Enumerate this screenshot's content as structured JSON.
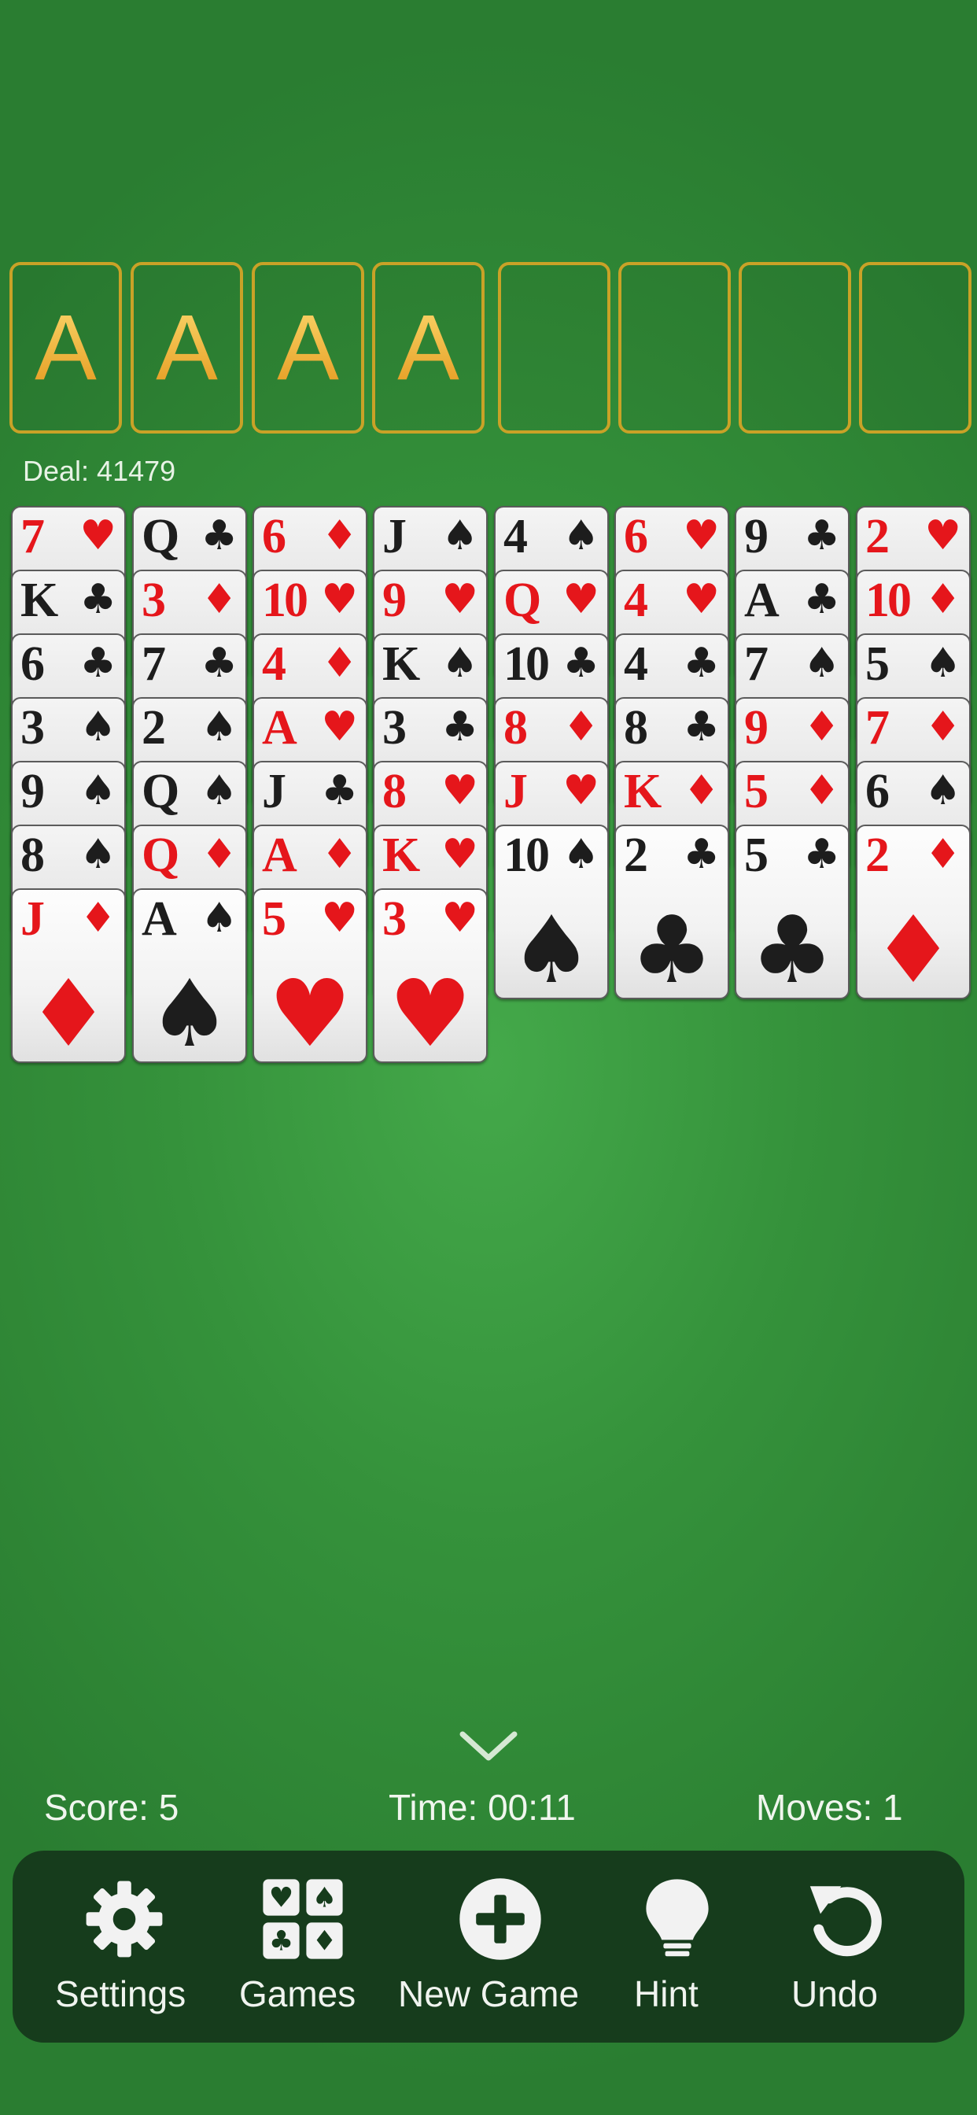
{
  "foundations": [
    "A",
    "A",
    "A",
    "A"
  ],
  "freecells": [
    "",
    "",
    "",
    ""
  ],
  "deal_label": "Deal: 41479",
  "columns": [
    [
      {
        "rank": "7",
        "suit": "hearts"
      },
      {
        "rank": "K",
        "suit": "clubs"
      },
      {
        "rank": "6",
        "suit": "clubs"
      },
      {
        "rank": "3",
        "suit": "spades"
      },
      {
        "rank": "9",
        "suit": "spades"
      },
      {
        "rank": "8",
        "suit": "spades"
      },
      {
        "rank": "J",
        "suit": "diamonds"
      }
    ],
    [
      {
        "rank": "Q",
        "suit": "clubs"
      },
      {
        "rank": "3",
        "suit": "diamonds"
      },
      {
        "rank": "7",
        "suit": "clubs"
      },
      {
        "rank": "2",
        "suit": "spades"
      },
      {
        "rank": "Q",
        "suit": "spades"
      },
      {
        "rank": "Q",
        "suit": "diamonds"
      },
      {
        "rank": "A",
        "suit": "spades"
      }
    ],
    [
      {
        "rank": "6",
        "suit": "diamonds"
      },
      {
        "rank": "10",
        "suit": "hearts"
      },
      {
        "rank": "4",
        "suit": "diamonds"
      },
      {
        "rank": "A",
        "suit": "hearts"
      },
      {
        "rank": "J",
        "suit": "clubs"
      },
      {
        "rank": "A",
        "suit": "diamonds"
      },
      {
        "rank": "5",
        "suit": "hearts"
      }
    ],
    [
      {
        "rank": "J",
        "suit": "spades"
      },
      {
        "rank": "9",
        "suit": "hearts"
      },
      {
        "rank": "K",
        "suit": "spades"
      },
      {
        "rank": "3",
        "suit": "clubs"
      },
      {
        "rank": "8",
        "suit": "hearts"
      },
      {
        "rank": "K",
        "suit": "hearts"
      },
      {
        "rank": "3",
        "suit": "hearts"
      }
    ],
    [
      {
        "rank": "4",
        "suit": "spades"
      },
      {
        "rank": "Q",
        "suit": "hearts"
      },
      {
        "rank": "10",
        "suit": "clubs"
      },
      {
        "rank": "8",
        "suit": "diamonds"
      },
      {
        "rank": "J",
        "suit": "hearts"
      },
      {
        "rank": "10",
        "suit": "spades"
      }
    ],
    [
      {
        "rank": "6",
        "suit": "hearts"
      },
      {
        "rank": "4",
        "suit": "hearts"
      },
      {
        "rank": "4",
        "suit": "clubs"
      },
      {
        "rank": "8",
        "suit": "clubs"
      },
      {
        "rank": "K",
        "suit": "diamonds"
      },
      {
        "rank": "2",
        "suit": "clubs"
      }
    ],
    [
      {
        "rank": "9",
        "suit": "clubs"
      },
      {
        "rank": "A",
        "suit": "clubs"
      },
      {
        "rank": "7",
        "suit": "spades"
      },
      {
        "rank": "9",
        "suit": "diamonds"
      },
      {
        "rank": "5",
        "suit": "diamonds"
      },
      {
        "rank": "5",
        "suit": "clubs"
      }
    ],
    [
      {
        "rank": "2",
        "suit": "hearts"
      },
      {
        "rank": "10",
        "suit": "diamonds"
      },
      {
        "rank": "5",
        "suit": "spades"
      },
      {
        "rank": "7",
        "suit": "diamonds"
      },
      {
        "rank": "6",
        "suit": "spades"
      },
      {
        "rank": "2",
        "suit": "diamonds"
      }
    ]
  ],
  "stats": {
    "score": "Score: 5",
    "time": "Time: 00:11",
    "moves": "Moves: 1"
  },
  "toolbar": {
    "settings": "Settings",
    "games": "Games",
    "new_game": "New Game",
    "hint": "Hint",
    "undo": "Undo"
  },
  "colors": {
    "felt": "#35923b",
    "slot_border": "#c9a227",
    "toolbar_bg": "#163c1c",
    "red_suit": "#e5161b",
    "black_suit": "#1d1d1d"
  }
}
